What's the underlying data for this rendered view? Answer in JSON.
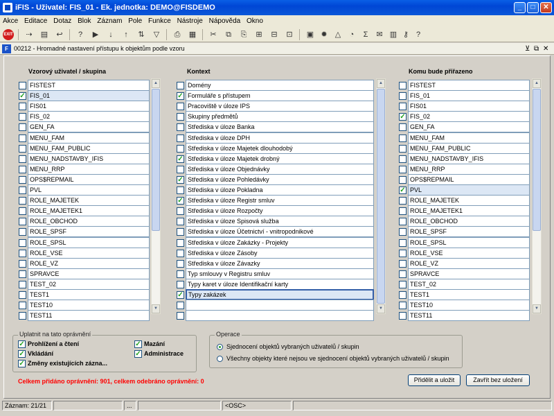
{
  "window": {
    "title": "iFIS - Uživatel: FIS_01 - Ek. jednotka: DEMO@FISDEMO"
  },
  "menu": [
    "Akce",
    "Editace",
    "Dotaz",
    "Blok",
    "Záznam",
    "Pole",
    "Funkce",
    "Nástroje",
    "Nápověda",
    "Okno"
  ],
  "toolbar": {
    "exit_label": "EXIT"
  },
  "form": {
    "title": "00212 - Hromadné nastavení přístupu k objektům podle vzoru",
    "col1_title": "Vzorový uživatel / skupina",
    "col2_title": "Kontext",
    "col3_title": "Komu bude přiřazeno"
  },
  "col1": [
    {
      "label": "FISTEST",
      "checked": false,
      "sel": false
    },
    {
      "label": "FIS_01",
      "checked": true,
      "sel": true
    },
    {
      "label": "FIS01",
      "checked": false,
      "sel": false
    },
    {
      "label": "FIS_02",
      "checked": false,
      "sel": false
    },
    {
      "label": "GEN_FA",
      "checked": false,
      "sel": false
    },
    {
      "label": "MENU_FAM",
      "checked": false,
      "sel": false
    },
    {
      "label": "MENU_FAM_PUBLIC",
      "checked": false,
      "sel": false
    },
    {
      "label": "MENU_NADSTAVBY_IFIS",
      "checked": false,
      "sel": false
    },
    {
      "label": "MENU_RRP",
      "checked": false,
      "sel": false
    },
    {
      "label": "OPS$REPMAIL",
      "checked": false,
      "sel": false
    },
    {
      "label": "PVL",
      "checked": false,
      "sel": false
    },
    {
      "label": "ROLE_MAJETEK",
      "checked": false,
      "sel": false
    },
    {
      "label": "ROLE_MAJETEK1",
      "checked": false,
      "sel": false
    },
    {
      "label": "ROLE_OBCHOD",
      "checked": false,
      "sel": false
    },
    {
      "label": "ROLE_SPSF",
      "checked": false,
      "sel": false
    },
    {
      "label": "ROLE_SPSL",
      "checked": false,
      "sel": false
    },
    {
      "label": "ROLE_VSE",
      "checked": false,
      "sel": false
    },
    {
      "label": "ROLE_VZ",
      "checked": false,
      "sel": false
    },
    {
      "label": "SPRAVCE",
      "checked": false,
      "sel": false
    },
    {
      "label": "TEST_02",
      "checked": false,
      "sel": false
    },
    {
      "label": "TEST1",
      "checked": false,
      "sel": false
    },
    {
      "label": "TEST10",
      "checked": false,
      "sel": false
    },
    {
      "label": "TEST11",
      "checked": false,
      "sel": false
    }
  ],
  "col2": [
    {
      "label": "Domény",
      "checked": false,
      "sel": false
    },
    {
      "label": "Formuláře s přístupem",
      "checked": true,
      "sel": false
    },
    {
      "label": "Pracoviště v úloze IPS",
      "checked": false,
      "sel": false
    },
    {
      "label": "Skupiny předmětů",
      "checked": false,
      "sel": false
    },
    {
      "label": "Střediska v úloze Banka",
      "checked": false,
      "sel": false
    },
    {
      "label": "Střediska v úloze DPH",
      "checked": false,
      "sel": false
    },
    {
      "label": "Střediska v úloze Majetek dlouhodobý",
      "checked": false,
      "sel": false
    },
    {
      "label": "Střediska v úloze Majetek drobný",
      "checked": true,
      "sel": false
    },
    {
      "label": "Střediska v úloze Objednávky",
      "checked": false,
      "sel": false
    },
    {
      "label": "Střediska v úloze Pohledávky",
      "checked": true,
      "sel": false
    },
    {
      "label": "Střediska v úloze Pokladna",
      "checked": false,
      "sel": false
    },
    {
      "label": "Střediska v úloze Registr smluv",
      "checked": true,
      "sel": false
    },
    {
      "label": "Střediska v úloze Rozpočty",
      "checked": false,
      "sel": false
    },
    {
      "label": "Střediska v úloze Spisová služba",
      "checked": false,
      "sel": false
    },
    {
      "label": "Střediska v úloze Účetnictví - vnitropodnikové",
      "checked": false,
      "sel": false
    },
    {
      "label": "Střediska v úloze Zakázky - Projekty",
      "checked": false,
      "sel": false
    },
    {
      "label": "Střediska v úloze Zásoby",
      "checked": false,
      "sel": false
    },
    {
      "label": "Střediska v úloze Závazky",
      "checked": false,
      "sel": false
    },
    {
      "label": "Typ smlouvy v Registru smluv",
      "checked": false,
      "sel": false
    },
    {
      "label": "Typy karet v úloze Identifikační karty",
      "checked": false,
      "sel": false
    },
    {
      "label": "Typy zakázek",
      "checked": true,
      "sel": true
    },
    {
      "label": "",
      "checked": false,
      "sel": false
    },
    {
      "label": "",
      "checked": false,
      "sel": false
    }
  ],
  "col3": [
    {
      "label": "FISTEST",
      "checked": false,
      "sel": false
    },
    {
      "label": "FIS_01",
      "checked": false,
      "sel": false
    },
    {
      "label": "FIS01",
      "checked": false,
      "sel": false
    },
    {
      "label": "FIS_02",
      "checked": true,
      "sel": false
    },
    {
      "label": "GEN_FA",
      "checked": false,
      "sel": false
    },
    {
      "label": "MENU_FAM",
      "checked": false,
      "sel": false
    },
    {
      "label": "MENU_FAM_PUBLIC",
      "checked": false,
      "sel": false
    },
    {
      "label": "MENU_NADSTAVBY_IFIS",
      "checked": false,
      "sel": false
    },
    {
      "label": "MENU_RRP",
      "checked": false,
      "sel": false
    },
    {
      "label": "OPS$REPMAIL",
      "checked": false,
      "sel": false
    },
    {
      "label": "PVL",
      "checked": true,
      "sel": true
    },
    {
      "label": "ROLE_MAJETEK",
      "checked": false,
      "sel": false
    },
    {
      "label": "ROLE_MAJETEK1",
      "checked": false,
      "sel": false
    },
    {
      "label": "ROLE_OBCHOD",
      "checked": false,
      "sel": false
    },
    {
      "label": "ROLE_SPSF",
      "checked": false,
      "sel": false
    },
    {
      "label": "ROLE_SPSL",
      "checked": false,
      "sel": false
    },
    {
      "label": "ROLE_VSE",
      "checked": false,
      "sel": false
    },
    {
      "label": "ROLE_VZ",
      "checked": false,
      "sel": false
    },
    {
      "label": "SPRAVCE",
      "checked": false,
      "sel": false
    },
    {
      "label": "TEST_02",
      "checked": false,
      "sel": false
    },
    {
      "label": "TEST1",
      "checked": false,
      "sel": false
    },
    {
      "label": "TEST10",
      "checked": false,
      "sel": false
    },
    {
      "label": "TEST11",
      "checked": false,
      "sel": false
    }
  ],
  "permissions": {
    "legend": "Uplatnit na tato oprávnění",
    "view": {
      "label": "Prohlížení a čtení",
      "checked": true
    },
    "insert": {
      "label": "Vkládání",
      "checked": true
    },
    "update": {
      "label": "Změny existujících zázna...",
      "checked": true
    },
    "delete": {
      "label": "Mazání",
      "checked": true
    },
    "admin": {
      "label": "Administrace",
      "checked": true
    }
  },
  "operations": {
    "legend": "Operace",
    "union": {
      "label": "Sjednocení objektů vybraných uživatelů / skupin",
      "selected": true
    },
    "other": {
      "label": "Všechny objekty které nejsou ve sjednocení objektů vybraných uživatelů / skupin",
      "selected": false
    }
  },
  "summary": "Celkem přidáno oprávnění: 901, celkem odebráno oprávnění: 0",
  "buttons": {
    "assign": "Přidělit a uložit",
    "close": "Zavřít bez uložení"
  },
  "status": {
    "record": "Záznam: 21/21",
    "ellipsis": "...",
    "mode": "<OSC>"
  }
}
